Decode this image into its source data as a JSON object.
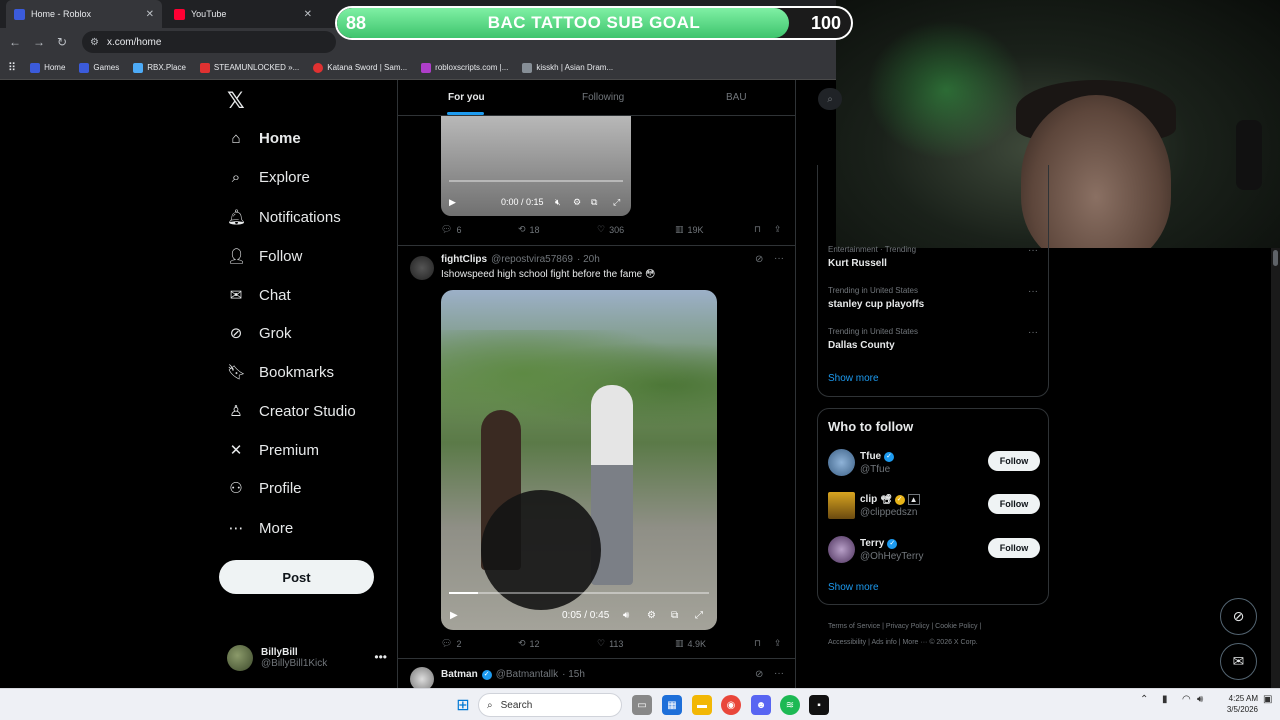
{
  "browser": {
    "tabs": [
      {
        "title": "Home - Roblox",
        "active": true
      },
      {
        "title": "YouTube",
        "active": false
      }
    ],
    "url": "x.com/home",
    "bookmarks": [
      "Home",
      "Games",
      "RBX.Place",
      "STEAMUNLOCKED »...",
      "Katana Sword | Sam...",
      "robloxscripts.com |...",
      "kisskh | Asian Dram..."
    ]
  },
  "overlay": {
    "goal_title": "BAC TATTOO SUB GOAL",
    "current": "88",
    "target": "100",
    "progress_fraction": 0.88
  },
  "nav": {
    "items": [
      {
        "label": "Home",
        "icon": "home-icon"
      },
      {
        "label": "Explore",
        "icon": "search-icon"
      },
      {
        "label": "Notifications",
        "icon": "bell-icon"
      },
      {
        "label": "Follow",
        "icon": "add-user-icon"
      },
      {
        "label": "Chat",
        "icon": "mail-icon"
      },
      {
        "label": "Grok",
        "icon": "grok-icon"
      },
      {
        "label": "Bookmarks",
        "icon": "bookmark-icon"
      },
      {
        "label": "Creator Studio",
        "icon": "creator-icon"
      },
      {
        "label": "Premium",
        "icon": "x-icon"
      },
      {
        "label": "Profile",
        "icon": "person-icon"
      },
      {
        "label": "More",
        "icon": "more-icon"
      }
    ],
    "post_label": "Post",
    "account": {
      "name": "BillyBill",
      "handle": "@BillyBill1Kick"
    }
  },
  "feed": {
    "tabs": [
      "For you",
      "Following",
      "BAU"
    ],
    "post0": {
      "video_time": "0:00 / 0:15",
      "replies": "6",
      "reposts": "18",
      "likes": "306",
      "views": "19K"
    },
    "post1": {
      "name": "fightClips",
      "handle": "@repostvira57869",
      "time": "· 20h",
      "text": "Ishowspeed high school fight before the fame 😳",
      "video_time": "0:05 / 0:45",
      "replies": "2",
      "reposts": "12",
      "likes": "113",
      "views": "4.9K"
    },
    "post2": {
      "name": "Batman",
      "handle": "@Batmantallk",
      "time": "· 15h"
    }
  },
  "sidebar": {
    "trends": [
      {
        "context": "Entertainment · Trending",
        "title": "Kurt Russell"
      },
      {
        "context": "Trending in United States",
        "title": "stanley cup playoffs"
      },
      {
        "context": "Trending in United States",
        "title": "Dallas County"
      }
    ],
    "trends_show_more": "Show more",
    "who_to_follow_title": "Who to follow",
    "who_to_follow": [
      {
        "name": "Tfue",
        "handle": "@Tfue",
        "button": "Follow"
      },
      {
        "name": "clip",
        "handle": "@clippedszn",
        "button": "Follow"
      },
      {
        "name": "Terry",
        "handle": "@OhHeyTerry",
        "button": "Follow"
      }
    ],
    "wtf_show_more": "Show more",
    "footer": [
      "Terms of Service",
      "Privacy Policy",
      "Cookie Policy",
      "Accessibility",
      "Ads info",
      "More ···",
      "© 2026 X Corp."
    ]
  },
  "taskbar": {
    "search_placeholder": "Search",
    "time": "4:25 AM",
    "date": "3/5/2026"
  }
}
